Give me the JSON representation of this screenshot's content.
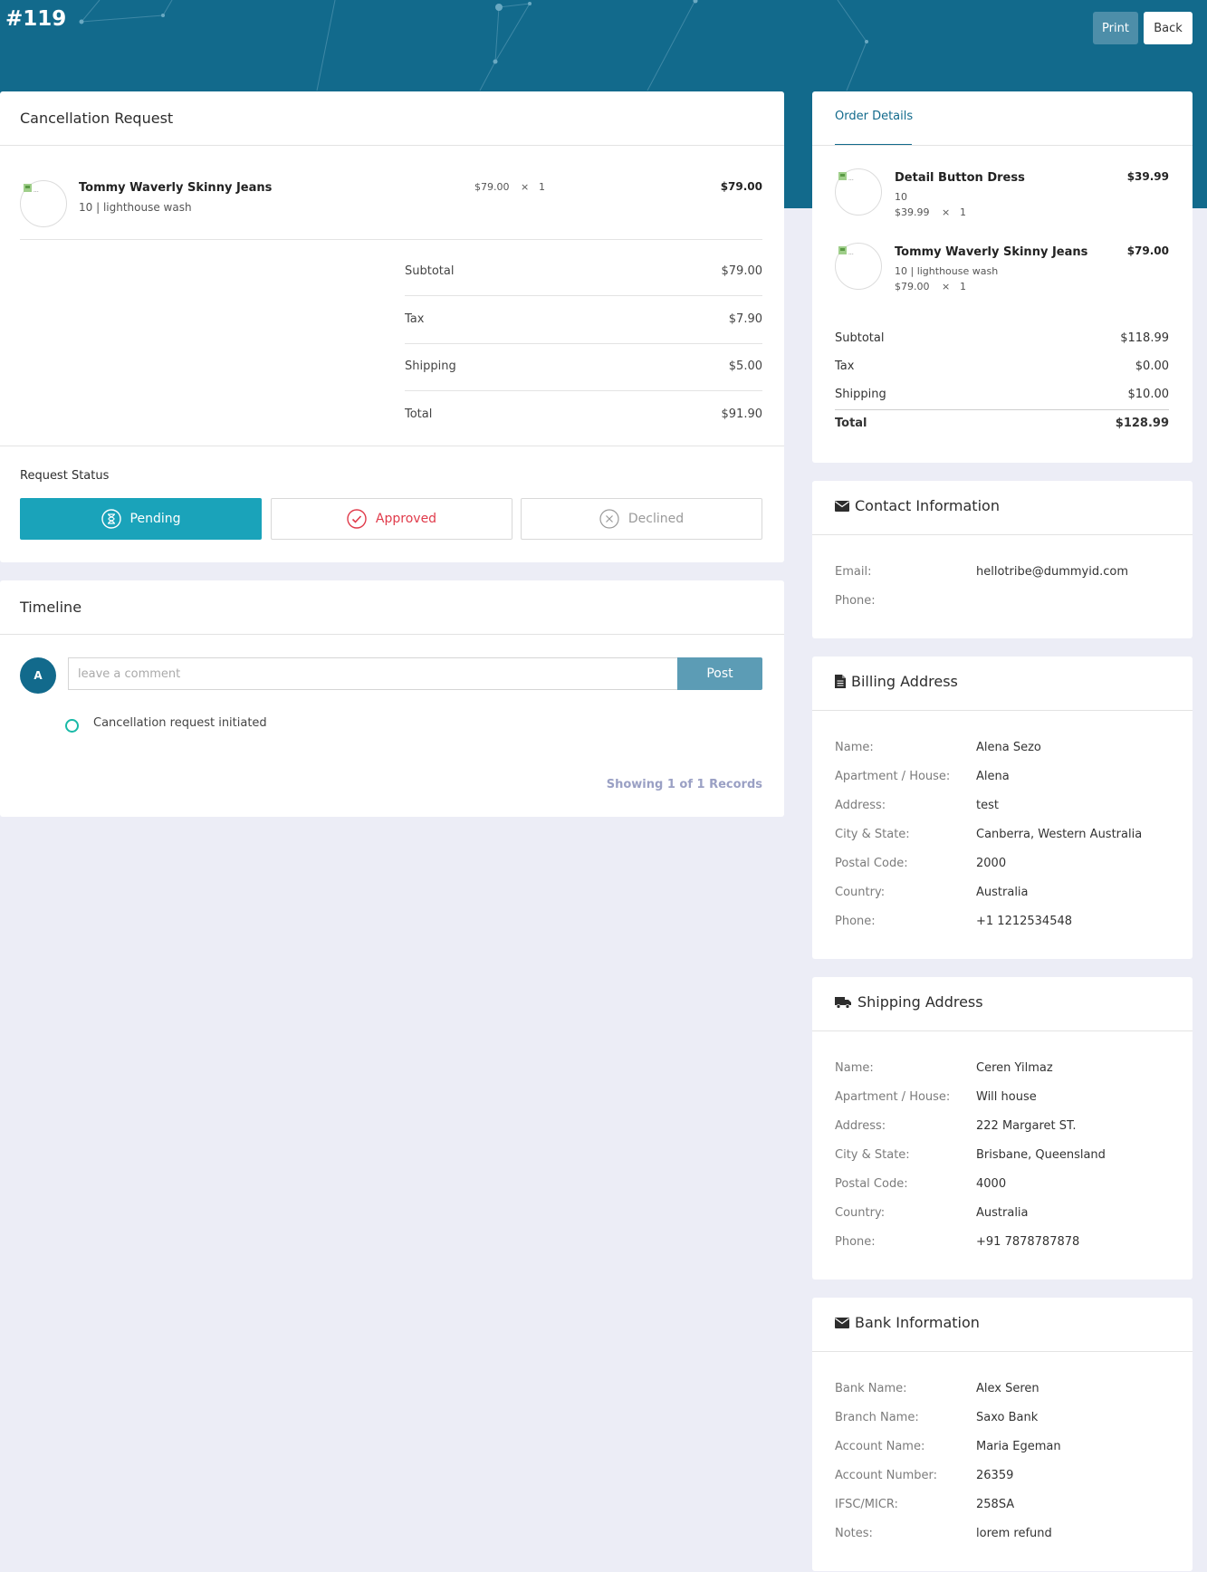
{
  "header": {
    "order_number": "#119",
    "print_label": "Print",
    "back_label": "Back"
  },
  "cancellation": {
    "title": "Cancellation Request",
    "item": {
      "name": "Tommy Waverly Skinny Jeans",
      "variant": "10 | lighthouse wash",
      "price": "$79.00",
      "times": "×",
      "qty": "1",
      "line_total": "$79.00"
    },
    "summary": [
      {
        "label": "Subtotal",
        "value": "$79.00"
      },
      {
        "label": "Tax",
        "value": "$7.90"
      },
      {
        "label": "Shipping",
        "value": "$5.00"
      },
      {
        "label": "Total",
        "value": "$91.90"
      }
    ],
    "status_title": "Request Status",
    "statuses": [
      {
        "label": "Pending",
        "active": true
      },
      {
        "label": "Approved",
        "active": false
      },
      {
        "label": "Declined",
        "active": false
      }
    ]
  },
  "timeline": {
    "title": "Timeline",
    "avatar_letter": "A",
    "comment_placeholder": "leave a comment",
    "post_label": "Post",
    "events": [
      "Cancellation request initiated"
    ],
    "records_text": "Showing 1 of 1 Records"
  },
  "order_details": {
    "tab_label": "Order Details",
    "items": [
      {
        "name": "Detail Button Dress",
        "variant": "10",
        "price": "$39.99",
        "times": "×",
        "qty": "1",
        "total": "$39.99"
      },
      {
        "name": "Tommy Waverly Skinny Jeans",
        "variant": "10 | lighthouse wash",
        "price": "$79.00",
        "times": "×",
        "qty": "1",
        "total": "$79.00"
      }
    ],
    "summary": [
      {
        "label": "Subtotal",
        "value": "$118.99"
      },
      {
        "label": "Tax",
        "value": "$0.00"
      },
      {
        "label": "Shipping",
        "value": "$10.00"
      },
      {
        "label": "Total",
        "value": "$128.99"
      }
    ]
  },
  "contact": {
    "title": "Contact Information",
    "rows": [
      {
        "label": "Email:",
        "value": "hellotribe@dummyid.com"
      },
      {
        "label": "Phone:",
        "value": ""
      }
    ]
  },
  "billing": {
    "title": "Billing Address",
    "rows": [
      {
        "label": "Name:",
        "value": "Alena Sezo"
      },
      {
        "label": "Apartment / House:",
        "value": "Alena"
      },
      {
        "label": "Address:",
        "value": "test"
      },
      {
        "label": "City & State:",
        "value": "Canberra, Western Australia"
      },
      {
        "label": "Postal Code:",
        "value": "2000"
      },
      {
        "label": "Country:",
        "value": "Australia"
      },
      {
        "label": "Phone:",
        "value": "+1 1212534548"
      }
    ]
  },
  "shipping": {
    "title": "Shipping Address",
    "rows": [
      {
        "label": "Name:",
        "value": "Ceren Yilmaz"
      },
      {
        "label": "Apartment / House:",
        "value": "Will house"
      },
      {
        "label": "Address:",
        "value": "222 Margaret ST."
      },
      {
        "label": "City & State:",
        "value": "Brisbane, Queensland"
      },
      {
        "label": "Postal Code:",
        "value": "4000"
      },
      {
        "label": "Country:",
        "value": "Australia"
      },
      {
        "label": "Phone:",
        "value": "+91 7878787878"
      }
    ]
  },
  "bank": {
    "title": "Bank Information",
    "rows": [
      {
        "label": "Bank Name:",
        "value": "Alex Seren"
      },
      {
        "label": "Branch Name:",
        "value": "Saxo Bank"
      },
      {
        "label": "Account Name:",
        "value": "Maria Egeman"
      },
      {
        "label": "Account Number:",
        "value": "26359"
      },
      {
        "label": "IFSC/MICR:",
        "value": "258SA"
      },
      {
        "label": "Notes:",
        "value": "lorem refund"
      }
    ]
  },
  "colors": {
    "header": "#126a8c",
    "pending": "#1aa3ba",
    "approved": "#e03a4a",
    "post_button": "#5c9cb5",
    "timeline_dot": "#19b9a7"
  }
}
